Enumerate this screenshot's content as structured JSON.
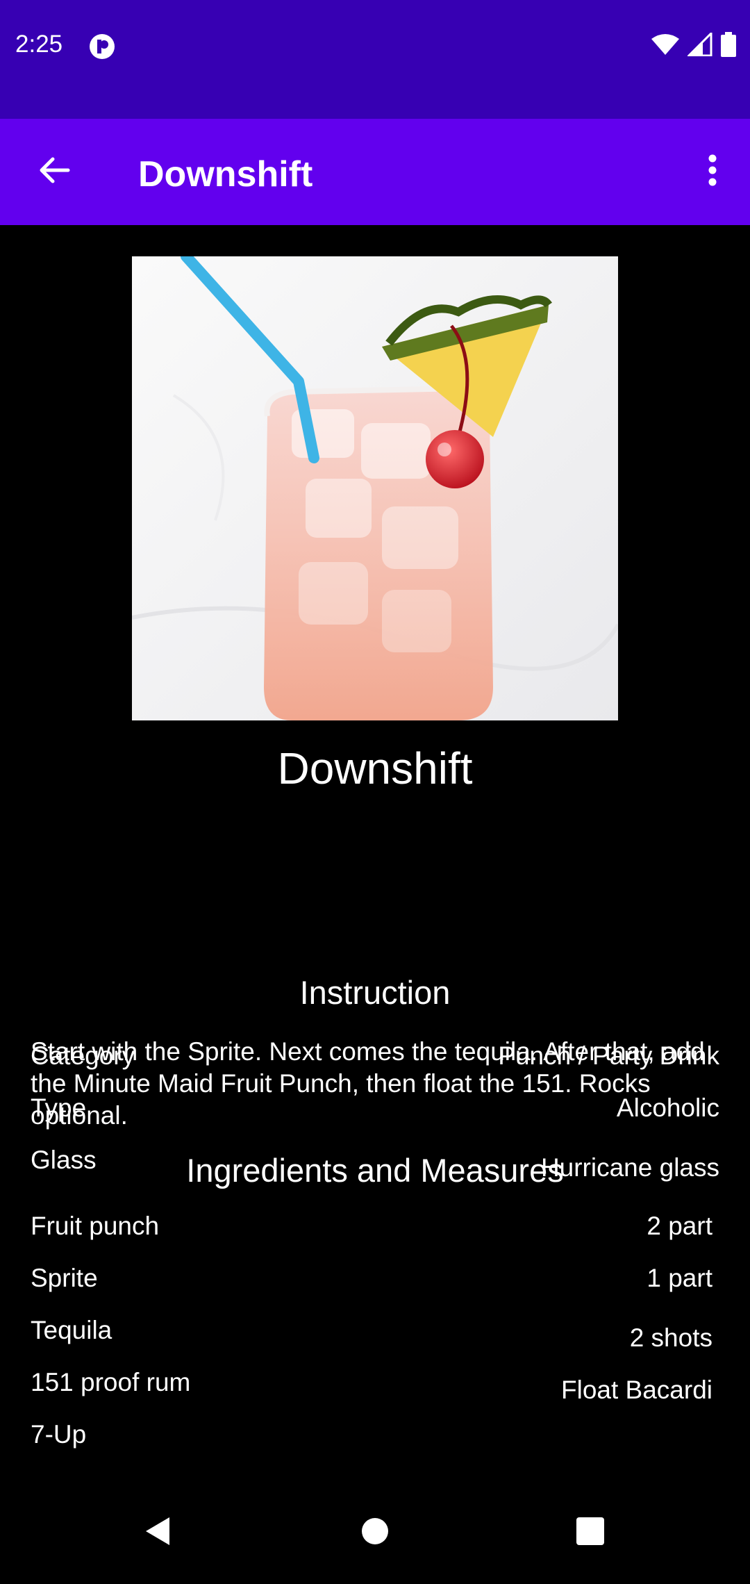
{
  "status_bar": {
    "time": "2:25",
    "icons": [
      "app-notification-icon",
      "wifi-icon",
      "cell-signal-icon",
      "battery-icon"
    ]
  },
  "app_bar": {
    "title": "Downshift",
    "back_icon": "arrow-back-icon",
    "menu_icon": "more-vert-icon",
    "background": "#6200ee",
    "status_background": "#3700b3"
  },
  "drink": {
    "name": "Downshift",
    "details": [
      {
        "label": "Category",
        "value": "Punch / Party Drink"
      },
      {
        "label": "Type",
        "value": "Alcoholic"
      },
      {
        "label": "Glass",
        "value": "Hurricane glass"
      }
    ],
    "instruction_title": "Instruction",
    "instruction": "Start with the Sprite. Next comes the tequila. After that, add the Minute Maid Fruit Punch, then float the 151. Rocks optional.",
    "ingredients_title": "Ingredients and Measures",
    "ingredients": [
      {
        "name": "Fruit punch",
        "measure": "2 part"
      },
      {
        "name": "Sprite",
        "measure": "1 part"
      },
      {
        "name": "Tequila",
        "measure": "2 shots"
      },
      {
        "name": "151 proof rum",
        "measure": "Float Bacardi"
      },
      {
        "name": "7-Up",
        "measure": ""
      }
    ]
  },
  "nav_bar": {
    "icons": [
      "back-triangle-icon",
      "home-circle-icon",
      "recents-square-icon"
    ]
  }
}
